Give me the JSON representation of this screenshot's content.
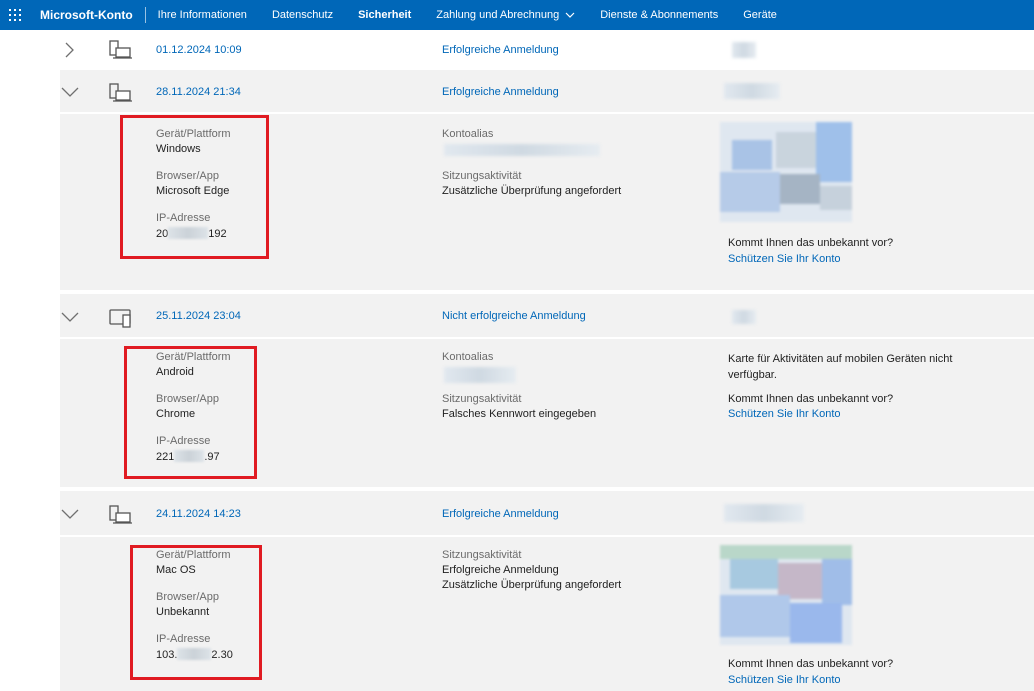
{
  "nav": {
    "brand": "Microsoft-Konto",
    "items": [
      "Ihre Informationen",
      "Datenschutz",
      "Sicherheit",
      "Zahlung und Abrechnung",
      "Dienste & Abonnements",
      "Geräte"
    ],
    "active": "Sicherheit"
  },
  "labels": {
    "device_platform": "Gerät/Plattform",
    "browser_app": "Browser/App",
    "ip_address": "IP-Adresse",
    "account_alias": "Kontoalias",
    "session_activity": "Sitzungsaktivität",
    "unknown_question": "Kommt Ihnen das unbekannt vor?",
    "protect_link": "Schützen Sie Ihr Konto",
    "map_unavailable": "Karte für Aktivitäten auf mobilen Geräten nicht verfügbar."
  },
  "rows": [
    {
      "date": "01.12.2024 10:09",
      "status": "Erfolgreiche Anmeldung",
      "device_icon": "desktop-icon"
    },
    {
      "date": "28.11.2024 21:34",
      "status": "Erfolgreiche Anmeldung",
      "device_icon": "desktop-icon",
      "platform": "Windows",
      "browser": "Microsoft Edge",
      "ip_prefix": "20",
      "ip_suffix": "192",
      "activity": "Zusätzliche Überprüfung angefordert"
    },
    {
      "date": "25.11.2024 23:04",
      "status": "Nicht erfolgreiche Anmeldung",
      "device_icon": "mobile-device-icon",
      "platform": "Android",
      "browser": "Chrome",
      "ip_prefix": "221",
      "ip_suffix": ".97",
      "activity": "Falsches Kennwort eingegeben"
    },
    {
      "date": "24.11.2024 14:23",
      "status": "Erfolgreiche Anmeldung",
      "device_icon": "desktop-icon",
      "platform": "Mac OS",
      "browser": "Unbekannt",
      "ip_prefix": "103.",
      "ip_suffix": "2.30",
      "activity_line1": "Erfolgreiche Anmeldung",
      "activity_line2": "Zusätzliche Überprüfung angefordert"
    }
  ],
  "colors": {
    "nav_bg": "#0067b8",
    "link": "#0067b8",
    "highlight": "#e01b22",
    "panel": "#f2f2f2"
  }
}
